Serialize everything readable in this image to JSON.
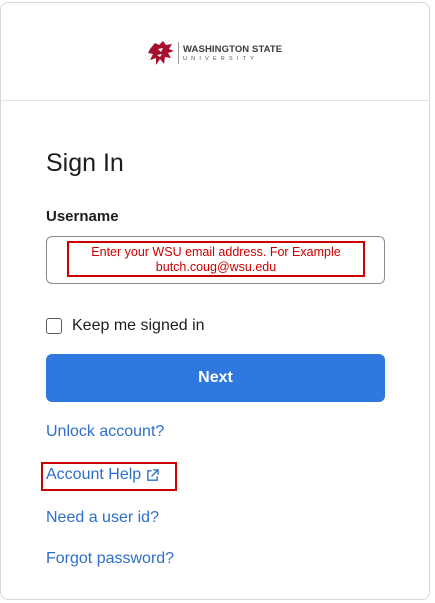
{
  "header": {
    "logo_title": "WASHINGTON STATE",
    "logo_subtitle": "UNIVERSITY",
    "logo_color": "#a60f2d"
  },
  "form": {
    "title": "Sign In",
    "username_label": "Username",
    "username_value": "",
    "hint_line1": "Enter your WSU email address. For Example",
    "hint_line2": "butch.coug@wsu.edu",
    "remember_label": "Keep me signed in",
    "remember_checked": false,
    "next_label": "Next",
    "button_color": "#2f78e0",
    "annotation_color": "#cc0000"
  },
  "links": {
    "unlock": "Unlock account?",
    "help": "Account Help",
    "help_icon": "external-link-icon",
    "userid": "Need a user id?",
    "forgot": "Forgot password?",
    "link_color": "#2d6fc9"
  }
}
